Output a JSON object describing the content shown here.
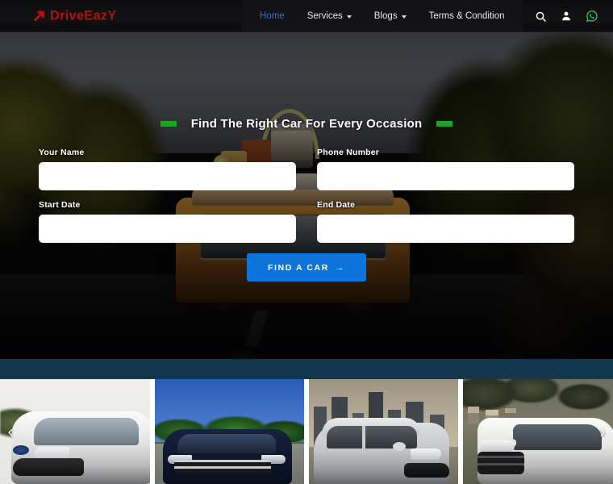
{
  "brand": {
    "name": "DriveEazY",
    "color": "#b3120f",
    "icon": "arrow-logo-icon"
  },
  "nav": {
    "items": [
      {
        "label": "Home",
        "active": true,
        "dropdown": false
      },
      {
        "label": "Services",
        "active": false,
        "dropdown": true
      },
      {
        "label": "Blogs",
        "active": false,
        "dropdown": true
      },
      {
        "label": "Terms & Condition",
        "active": false,
        "dropdown": false
      }
    ],
    "icons": [
      {
        "name": "search-icon",
        "color": "#ffffff"
      },
      {
        "name": "user-icon",
        "color": "#ffffff"
      },
      {
        "name": "whatsapp-icon",
        "color": "#25d366"
      }
    ],
    "active_color": "#2f6fe0"
  },
  "hero": {
    "title": "Find The Right Car For Every Occasion",
    "dash_color": "#1fa322",
    "form": {
      "fields": [
        {
          "label": "Your Name",
          "value": "",
          "placeholder": ""
        },
        {
          "label": "Phone Number",
          "value": "",
          "placeholder": ""
        },
        {
          "label": "Start Date",
          "value": "",
          "placeholder": ""
        },
        {
          "label": "End Date",
          "value": "",
          "placeholder": ""
        }
      ],
      "submit_label": "FIND A CAR",
      "submit_arrow": "→",
      "submit_color": "#0c74da"
    }
  },
  "band": {
    "color": "#15364f"
  },
  "carousel": {
    "prev_arrow": "‹",
    "next_arrow": "›",
    "slides": [
      {
        "name": "white-compact-suv"
      },
      {
        "name": "dark-blue-mpv"
      },
      {
        "name": "silver-hatchback"
      },
      {
        "name": "white-suv"
      }
    ]
  }
}
